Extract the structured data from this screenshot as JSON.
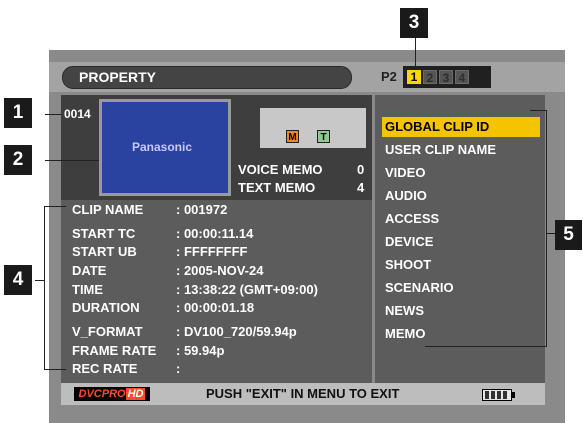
{
  "header": {
    "title": "PROPERTY",
    "card_label": "P2",
    "slots": [
      "1",
      "2",
      "3",
      "4"
    ],
    "active_slot": "1"
  },
  "thumbnail": {
    "clip_number": "0014",
    "brand_text": "Panasonic"
  },
  "memo": {
    "icon_m": "M",
    "icon_t": "T",
    "voice_label": "VOICE MEMO",
    "voice_count": "0",
    "text_label": "TEXT MEMO",
    "text_count": "4"
  },
  "properties": [
    {
      "label": "CLIP NAME",
      "value": ": 001972"
    },
    {
      "label": "START TC",
      "value": ": 00:00:11.14"
    },
    {
      "label": "START UB",
      "value": ": FFFFFFFF"
    },
    {
      "label": "DATE",
      "value": ": 2005-NOV-24"
    },
    {
      "label": "TIME",
      "value": ": 13:38:22 (GMT+09:00)"
    },
    {
      "label": "DURATION",
      "value": ": 00:00:01.18"
    },
    {
      "label": "V_FORMAT",
      "value": ": DV100_720/59.94p"
    },
    {
      "label": "FRAME RATE",
      "value": ": 59.94p"
    },
    {
      "label": "REC RATE",
      "value": ":"
    }
  ],
  "menu": [
    "GLOBAL CLIP ID",
    "USER CLIP NAME",
    "VIDEO",
    "AUDIO",
    "ACCESS",
    "DEVICE",
    "SHOOT",
    "SCENARIO",
    "NEWS",
    "MEMO"
  ],
  "menu_selected_index": 0,
  "footer": {
    "logo_text": "DVCPRO",
    "logo_hd": "HD",
    "message": "PUSH \"EXIT\" IN MENU TO EXIT",
    "battery_level": 0.8
  },
  "callouts": [
    "1",
    "2",
    "3",
    "4",
    "5"
  ],
  "colors": {
    "highlight": "#f5c400",
    "panel": "#5c5c5c",
    "thumbnail": "#2b43a0"
  }
}
